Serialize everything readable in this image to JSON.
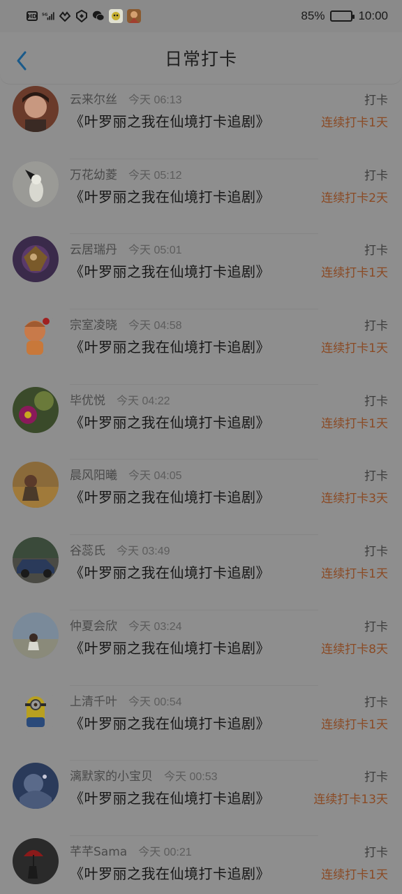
{
  "status_bar": {
    "battery_text": "85%",
    "battery_level": 0.85,
    "time": "10:00",
    "hd_label": "HD",
    "net_label": "5G",
    "icons": [
      "hd-icon",
      "signal-icon",
      "heart-link-icon",
      "shield-icon",
      "wechat-icon",
      "app-icon-1",
      "app-icon-2"
    ]
  },
  "header": {
    "title": "日常打卡",
    "back_icon": "chevron-left-icon",
    "accent_color": "#1a5a8a"
  },
  "colors": {
    "streak": "#8a4a24",
    "text_primary": "#161616",
    "text_secondary": "#4a4a4a"
  },
  "entries": [
    {
      "username": "云来尔丝",
      "time": "今天 06:13",
      "show": "《叶罗丽之我在仙境打卡追剧》",
      "action": "打卡",
      "streak": "连续打卡1天",
      "avatar": "portrait-man"
    },
    {
      "username": "万花幼菱",
      "time": "今天 05:12",
      "show": "《叶罗丽之我在仙境打卡追剧》",
      "action": "打卡",
      "streak": "连续打卡2天",
      "avatar": "anime-bird"
    },
    {
      "username": "云居瑞丹",
      "time": "今天 05:01",
      "show": "《叶罗丽之我在仙境打卡追剧》",
      "action": "打卡",
      "streak": "连续打卡1天",
      "avatar": "game-character"
    },
    {
      "username": "宗室凌晓",
      "time": "今天 04:58",
      "show": "《叶罗丽之我在仙境打卡追剧》",
      "action": "打卡",
      "streak": "连续打卡1天",
      "avatar": "cartoon-boy"
    },
    {
      "username": "毕优悦",
      "time": "今天 04:22",
      "show": "《叶罗丽之我在仙境打卡追剧》",
      "action": "打卡",
      "streak": "连续打卡1天",
      "avatar": "cactus-flower"
    },
    {
      "username": "晨风阳曦",
      "time": "今天 04:05",
      "show": "《叶罗丽之我在仙境打卡追剧》",
      "action": "打卡",
      "streak": "连续打卡3天",
      "avatar": "girl-in-field"
    },
    {
      "username": "谷蕊氏",
      "time": "今天 03:49",
      "show": "《叶罗丽之我在仙境打卡追剧》",
      "action": "打卡",
      "streak": "连续打卡1天",
      "avatar": "vintage-car"
    },
    {
      "username": "仲夏会欣",
      "time": "今天 03:24",
      "show": "《叶罗丽之我在仙境打卡追剧》",
      "action": "打卡",
      "streak": "连续打卡8天",
      "avatar": "beach-girl"
    },
    {
      "username": "上清千叶",
      "time": "今天 00:54",
      "show": "《叶罗丽之我在仙境打卡追剧》",
      "action": "打卡",
      "streak": "连续打卡1天",
      "avatar": "minion"
    },
    {
      "username": "漓默家的小宝贝",
      "time": "今天 00:53",
      "show": "《叶罗丽之我在仙境打卡追剧》",
      "action": "打卡",
      "streak": "连续打卡13天",
      "avatar": "blue-anime"
    },
    {
      "username": "芊芊Sama",
      "time": "今天 00:21",
      "show": "《叶罗丽之我在仙境打卡追剧》",
      "action": "打卡",
      "streak": "连续打卡1天",
      "avatar": "red-umbrella"
    }
  ]
}
